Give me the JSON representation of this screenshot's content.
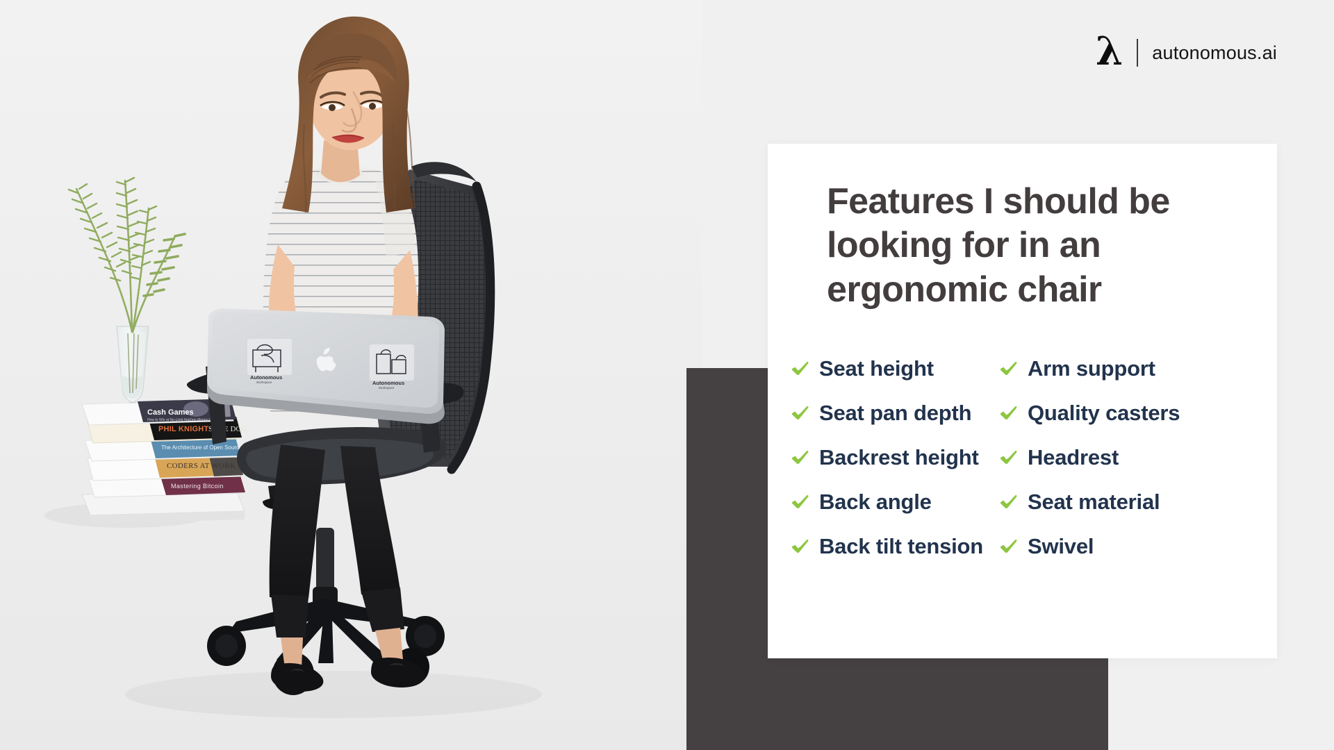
{
  "brand": {
    "logo_icon": "lambda-logo-icon",
    "divider_icon": "vertical-divider-icon",
    "name": "autonomous.ai"
  },
  "card": {
    "headline": "Features I should be looking for in an ergonomic chair",
    "checklist": {
      "check_icon_name": "green-checkmark-icon",
      "items": [
        {
          "label": "Seat height",
          "column": "left"
        },
        {
          "label": "Arm support",
          "column": "right"
        },
        {
          "label": "Seat pan depth",
          "column": "left"
        },
        {
          "label": "Quality casters",
          "column": "right"
        },
        {
          "label": "Backrest height",
          "column": "left"
        },
        {
          "label": "Headrest",
          "column": "right"
        },
        {
          "label": "Back angle",
          "column": "left"
        },
        {
          "label": "Seat material",
          "column": "right"
        },
        {
          "label": "Back tilt tension",
          "column": "left"
        },
        {
          "label": "Swivel",
          "column": "right"
        }
      ]
    }
  },
  "photo": {
    "alt": "Woman in striped t-shirt sitting on a black mesh ergonomic office chair working on a silver laptop, beside a glass vase with fern fronds on a stack of books",
    "book_titles": [
      "Cash Games",
      "PHIL KNIGHT SHOE DOG",
      "The Architecture of Open Source Applications",
      "CODERS AT WORK",
      "Mastering Bitcoin"
    ],
    "laptop_stickers": [
      "Autonomous",
      "apple-logo-icon",
      "Autonomous"
    ]
  },
  "colors": {
    "background": "#f0f0f0",
    "card_background": "#ffffff",
    "dark_panel": "#454041",
    "headline_text": "#433d3e",
    "check_green": "#8dc63f",
    "item_text_navy": "#22334d",
    "brand_text": "#141414"
  }
}
